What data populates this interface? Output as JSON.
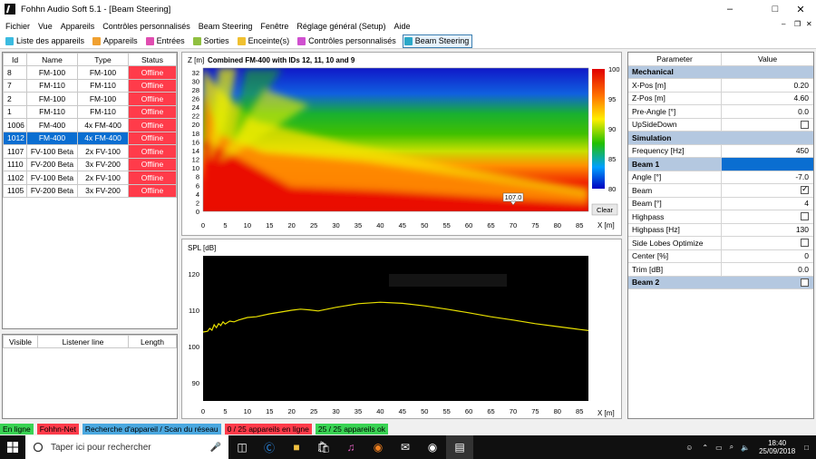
{
  "window": {
    "title": "Fohhn Audio Soft 5.1 - [Beam Steering]"
  },
  "menu": [
    "Fichier",
    "Vue",
    "Appareils",
    "Contrôles personnalisés",
    "Beam Steering",
    "Fenêtre",
    "Réglage général (Setup)",
    "Aide"
  ],
  "toolbar": [
    {
      "label": "Liste des appareils",
      "color": "#3bbbe0"
    },
    {
      "label": "Appareils",
      "color": "#f0a030"
    },
    {
      "label": "Entrées",
      "color": "#e04db0"
    },
    {
      "label": "Sorties",
      "color": "#90c040"
    },
    {
      "label": "Enceinte(s)",
      "color": "#f0c030"
    },
    {
      "label": "Contrôles personnalisés",
      "color": "#d050d0"
    },
    {
      "label": "Beam Steering",
      "color": "#2aa8c8"
    }
  ],
  "devices": {
    "headers": [
      "Id",
      "Name",
      "Type",
      "Status"
    ],
    "rows": [
      [
        "8",
        "FM-100",
        "FM-100",
        "Offline"
      ],
      [
        "7",
        "FM-110",
        "FM-110",
        "Offline"
      ],
      [
        "2",
        "FM-100",
        "FM-100",
        "Offline"
      ],
      [
        "1",
        "FM-110",
        "FM-110",
        "Offline"
      ],
      [
        "1006",
        "FM-400",
        "4x FM-400",
        "Offline"
      ],
      [
        "1012",
        "FM-400",
        "4x FM-400",
        "Offline"
      ],
      [
        "1107",
        "FV-100 Beta",
        "2x FV-100",
        "Offline"
      ],
      [
        "1110",
        "FV-200 Beta",
        "3x FV-200",
        "Offline"
      ],
      [
        "1102",
        "FV-100 Beta",
        "2x FV-100",
        "Offline"
      ],
      [
        "1105",
        "FV-200 Beta",
        "3x FV-200",
        "Offline"
      ]
    ],
    "selected_index": 5
  },
  "listener": {
    "headers": [
      "Visible",
      "Listener line",
      "Length"
    ]
  },
  "heatmap": {
    "title": "Combined FM-400 with IDs 12, 11, 10 and 9",
    "ylabel": "Z [m]",
    "xlabel": "X [m]",
    "yticks": [
      "32",
      "30",
      "28",
      "26",
      "24",
      "22",
      "20",
      "18",
      "16",
      "14",
      "12",
      "10",
      "8",
      "6",
      "4",
      "2",
      "0"
    ],
    "xticks": [
      "0",
      "5",
      "10",
      "15",
      "20",
      "25",
      "30",
      "35",
      "40",
      "45",
      "50",
      "55",
      "60",
      "65",
      "70",
      "75",
      "80",
      "85"
    ],
    "colorbar_ticks": [
      "100",
      "95",
      "90",
      "85",
      "80"
    ],
    "marker_value": "107.0",
    "clear_label": "Clear"
  },
  "chart_data": {
    "type": "line",
    "ylabel": "SPL [dB]",
    "xlabel": "X [m]",
    "xlim": [
      0,
      87
    ],
    "ylim": [
      85,
      125
    ],
    "yticks": [
      120,
      110,
      100,
      90
    ],
    "xticks": [
      0,
      5,
      10,
      15,
      20,
      25,
      30,
      35,
      40,
      45,
      50,
      55,
      60,
      65,
      70,
      75,
      80,
      85
    ],
    "grid": false,
    "series": [
      {
        "color": "#e8e000",
        "x": [
          0,
          1,
          1.5,
          2,
          2.5,
          3,
          3.5,
          4,
          4.5,
          5,
          6,
          7,
          8,
          10,
          12,
          15,
          18,
          20,
          22,
          24,
          26,
          28,
          30,
          35,
          40,
          45,
          50,
          55,
          60,
          65,
          70,
          75,
          80,
          85,
          87
        ],
        "y": [
          104,
          104.2,
          105,
          104.5,
          106,
          105.2,
          106.3,
          105.8,
          106.8,
          106.2,
          107,
          106.8,
          107.3,
          108,
          108.2,
          109,
          109.6,
          110,
          110.3,
          110.1,
          109.8,
          110.3,
          110.8,
          111.8,
          112.2,
          111.9,
          111.2,
          110.3,
          109.3,
          108.2,
          107.3,
          106.3,
          105.5,
          104.7,
          104.4
        ]
      }
    ]
  },
  "params": {
    "headers": [
      "Parameter",
      "Value"
    ],
    "rows": [
      {
        "kind": "section",
        "name": "Mechanical"
      },
      {
        "name": "X-Pos [m]",
        "value": "0.20"
      },
      {
        "name": "Z-Pos [m]",
        "value": "4.60"
      },
      {
        "name": "Pre-Angle [°]",
        "value": "0.0"
      },
      {
        "name": "UpSideDown",
        "check": false
      },
      {
        "kind": "section",
        "name": "Simulation"
      },
      {
        "name": "Frequency [Hz]",
        "value": "450"
      },
      {
        "kind": "section",
        "name": "Beam 1",
        "highlight": true
      },
      {
        "name": "Angle [°]",
        "value": "-7.0"
      },
      {
        "name": "Beam",
        "check": true
      },
      {
        "name": "Beam [°]",
        "value": "4"
      },
      {
        "name": "Highpass",
        "check": false
      },
      {
        "name": "Highpass [Hz]",
        "value": "130"
      },
      {
        "name": "Side Lobes Optimize",
        "check": false
      },
      {
        "name": "Center [%]",
        "value": "0"
      },
      {
        "name": "Trim [dB]",
        "value": "0.0"
      },
      {
        "kind": "section",
        "name": "Beam 2",
        "check": false
      }
    ]
  },
  "status": [
    {
      "label": "En ligne",
      "color": "#39d353"
    },
    {
      "label": "Fohhn-Net",
      "color": "#ff3b4a"
    },
    {
      "label": "Recherche d'appareil / Scan du réseau",
      "color": "#4aa8e0"
    },
    {
      "label": "0 / 25 appareils en ligne",
      "color": "#ff3b4a"
    },
    {
      "label": "25 / 25 appareils ok",
      "color": "#39d353"
    }
  ],
  "taskbar": {
    "search_placeholder": "Taper ici pour rechercher",
    "time": "18:40",
    "date": "25/09/2018"
  }
}
